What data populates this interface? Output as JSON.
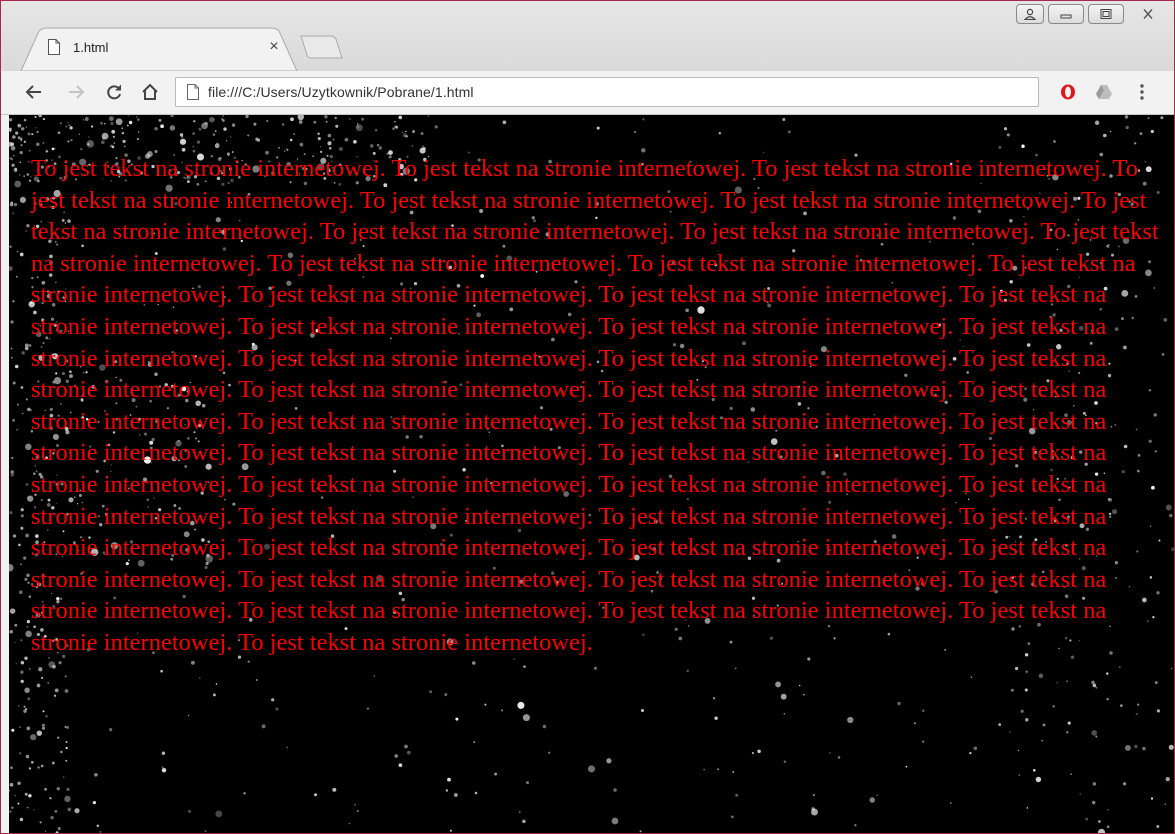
{
  "browser": {
    "tab": {
      "title": "1.html",
      "close_glyph": "×",
      "icon": "page-icon"
    },
    "toolbar": {
      "url": "file:///C:/Users/Uzytkownik/Pobrane/1.html",
      "back_icon": "arrow-left-icon",
      "forward_icon": "arrow-right-icon",
      "reload_icon": "reload-icon",
      "home_icon": "home-icon",
      "extensions": [
        "opera-icon",
        "drive-icon"
      ],
      "menu_icon": "kebab-menu-icon"
    },
    "window_controls": [
      "user-icon",
      "minimize-icon",
      "maximize-icon",
      "close-icon"
    ]
  },
  "page": {
    "background_color": "#000000",
    "text_color": "#ff0000",
    "text": "To jest tekst na stronie internetowej. To jest tekst na stronie internetowej. To jest tekst na stronie internetowej. To jest tekst na stronie internetowej. To jest tekst na stronie internetowej. To jest tekst na stronie internetowej. To jest tekst na stronie internetowej. To jest tekst na stronie internetowej. To jest tekst na stronie internetowej. To jest tekst na stronie internetowej. To jest tekst na stronie internetowej. To jest tekst na stronie internetowej. To jest tekst na stronie internetowej. To jest tekst na stronie internetowej. To jest tekst na stronie internetowej. To jest tekst na stronie internetowej. To jest tekst na stronie internetowej. To jest tekst na stronie internetowej. To jest tekst na stronie internetowej. To jest tekst na stronie internetowej. To jest tekst na stronie internetowej. To jest tekst na stronie internetowej. To jest tekst na stronie internetowej. To jest tekst na stronie internetowej. To jest tekst na stronie internetowej. To jest tekst na stronie internetowej. To jest tekst na stronie internetowej. To jest tekst na stronie internetowej. To jest tekst na stronie internetowej. To jest tekst na stronie internetowej. To jest tekst na stronie internetowej. To jest tekst na stronie internetowej. To jest tekst na stronie internetowej. To jest tekst na stronie internetowej. To jest tekst na stronie internetowej. To jest tekst na stronie internetowej. To jest tekst na stronie internetowej. To jest tekst na stronie internetowej. To jest tekst na stronie internetowej. To jest tekst na stronie internetowej. To jest tekst na stronie internetowej. To jest tekst na stronie internetowej. To jest tekst na stronie internetowej. To jest tekst na stronie internetowej. To jest tekst na stronie internetowej. To jest tekst na stronie internetowej. To jest tekst na stronie internetowej."
  }
}
